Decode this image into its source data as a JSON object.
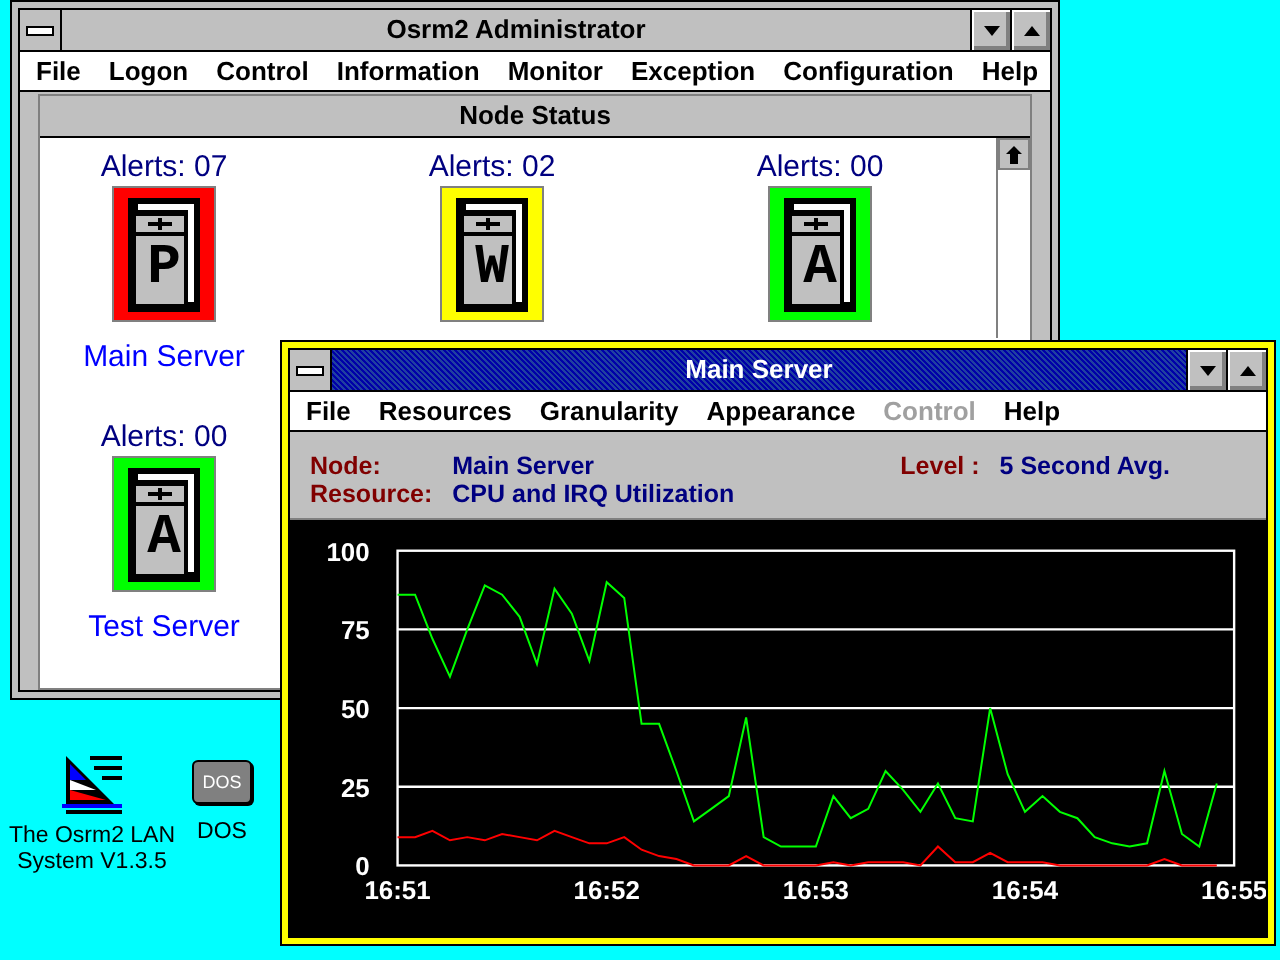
{
  "desktop_icons": [
    {
      "kind": "app",
      "label": "The Osrm2 LAN System V1.3.5"
    },
    {
      "kind": "dos",
      "badge": "DOS",
      "label": "DOS"
    }
  ],
  "admin_window": {
    "title": "Osrm2 Administrator",
    "active": false,
    "menu": [
      "File",
      "Logon",
      "Control",
      "Information",
      "Monitor",
      "Exception",
      "Configuration",
      "Help"
    ],
    "panel": {
      "title": "Node Status",
      "nodes": [
        {
          "alerts": "Alerts: 07",
          "letter": "P",
          "color": "#ff0000",
          "label": "Main Server"
        },
        {
          "alerts": "Alerts: 02",
          "letter": "W",
          "color": "#ffff00"
        },
        {
          "alerts": "Alerts: 00",
          "letter": "A",
          "color": "#00ff00"
        },
        {
          "alerts": "Alerts: 00",
          "letter": "A",
          "color": "#00ff00",
          "label": "Test Server"
        }
      ]
    }
  },
  "monitor_window": {
    "title": "Main Server",
    "active": true,
    "menu": [
      {
        "label": "File",
        "disabled": false
      },
      {
        "label": "Resources",
        "disabled": false
      },
      {
        "label": "Granularity",
        "disabled": false
      },
      {
        "label": "Appearance",
        "disabled": false
      },
      {
        "label": "Control",
        "disabled": true
      },
      {
        "label": "Help",
        "disabled": false
      }
    ],
    "info": {
      "node_label": "Node:",
      "node": "Main Server",
      "level_label": "Level :",
      "level": "5 Second Avg.",
      "resource_label": "Resource:",
      "resource": "CPU and IRQ Utilization"
    },
    "chart_data": {
      "type": "line",
      "ylim": [
        0,
        100
      ],
      "grid": true,
      "categories": [
        "16:51",
        null,
        null,
        null,
        null,
        null,
        null,
        null,
        null,
        null,
        null,
        null,
        "16:52",
        null,
        null,
        null,
        null,
        null,
        null,
        null,
        null,
        null,
        null,
        null,
        "16:53",
        null,
        null,
        null,
        null,
        null,
        null,
        null,
        null,
        null,
        null,
        null,
        "16:54",
        null,
        null,
        null,
        null,
        null,
        null,
        null,
        null,
        null,
        null,
        null,
        "16:55"
      ],
      "yticks": [
        0,
        25,
        50,
        75,
        100
      ],
      "series": [
        {
          "color": "#00ff00",
          "values": [
            86,
            86,
            72,
            60,
            75,
            89,
            86,
            79,
            64,
            88,
            80,
            65,
            90,
            85,
            45,
            45,
            30,
            14,
            18,
            22,
            47,
            9,
            6,
            6,
            6,
            22,
            15,
            18,
            30,
            24,
            17,
            26,
            15,
            14,
            50,
            29,
            17,
            22,
            17,
            15,
            9,
            7,
            6,
            7,
            30,
            10,
            6,
            26,
            null
          ]
        },
        {
          "color": "#ff0000",
          "values": [
            9,
            9,
            11,
            8,
            9,
            8,
            10,
            9,
            8,
            11,
            9,
            7,
            7,
            9,
            5,
            3,
            2,
            0,
            0,
            0,
            3,
            0,
            0,
            0,
            0,
            1,
            0,
            1,
            1,
            1,
            0,
            6,
            1,
            1,
            4,
            1,
            1,
            1,
            0,
            0,
            0,
            0,
            0,
            0,
            2,
            0,
            0,
            0,
            null
          ]
        }
      ]
    }
  }
}
